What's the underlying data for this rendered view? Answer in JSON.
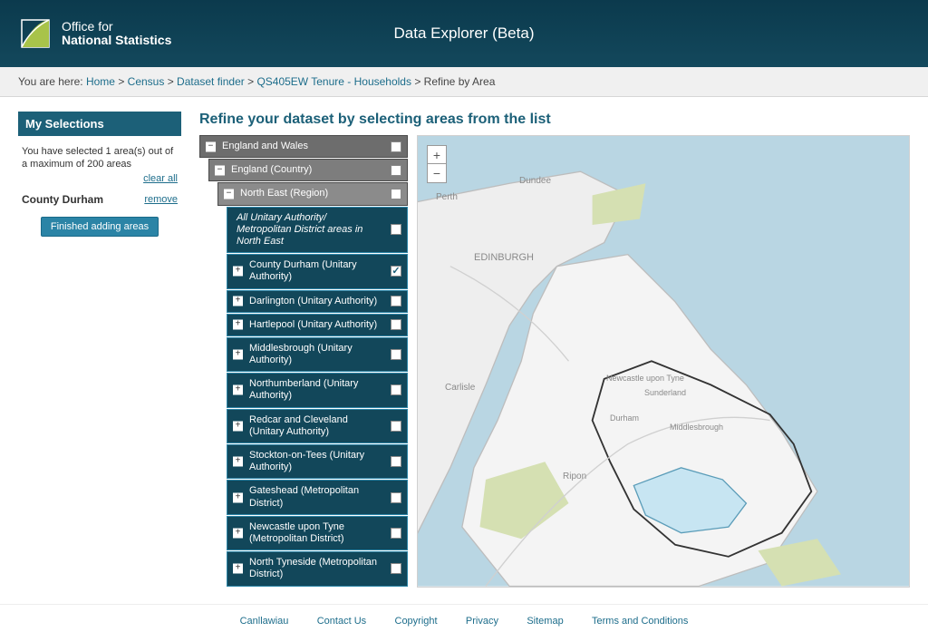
{
  "header": {
    "org_line1": "Office for",
    "org_line2": "National Statistics",
    "app_title": "Data Explorer (Beta)"
  },
  "breadcrumb": {
    "prefix": "You are here: ",
    "items": [
      "Home",
      "Census",
      "Dataset finder",
      "QS405EW Tenure - Households",
      "Refine by Area"
    ],
    "sep": " > "
  },
  "sidebar": {
    "title": "My Selections",
    "summary": "You have selected 1 area(s) out of a maximum of 200 areas",
    "clear_all": "clear all",
    "selected": {
      "name": "County Durham",
      "remove_label": "remove"
    },
    "finished_label": "Finished adding areas"
  },
  "main": {
    "heading": "Refine your dataset by selecting areas from the list"
  },
  "tree": {
    "l0": {
      "label": "England and Wales",
      "expanded": true
    },
    "l1": {
      "label": "England (Country)",
      "expanded": true
    },
    "l2": {
      "label": "North East (Region)",
      "expanded": true
    },
    "all_areas": "All Unitary Authority/ Metropolitan District areas in North East",
    "items": [
      {
        "label": "County Durham (Unitary Authority)",
        "checked": true
      },
      {
        "label": "Darlington (Unitary Authority)",
        "checked": false
      },
      {
        "label": "Hartlepool (Unitary Authority)",
        "checked": false
      },
      {
        "label": "Middlesbrough (Unitary Authority)",
        "checked": false
      },
      {
        "label": "Northumberland (Unitary Authority)",
        "checked": false
      },
      {
        "label": "Redcar and Cleveland (Unitary Authority)",
        "checked": false
      },
      {
        "label": "Stockton-on-Tees (Unitary Authority)",
        "checked": false
      },
      {
        "label": "Gateshead (Metropolitan District)",
        "checked": false
      },
      {
        "label": "Newcastle upon Tyne (Metropolitan District)",
        "checked": false
      },
      {
        "label": "North Tyneside (Metropolitan District)",
        "checked": false
      }
    ]
  },
  "map": {
    "labels": {
      "perth": "Perth",
      "dundee": "Dundee",
      "edinburgh": "EDINBURGH",
      "carlisle": "Carlisle",
      "newcastle": "Newcastle upon Tyne",
      "sunderland": "Sunderland",
      "durham": "Durham",
      "middlesbrough": "Middlesbrough",
      "ripon": "Ripon"
    },
    "highlight_color": "#c7e5f2"
  },
  "footer": {
    "links": [
      "Canllawiau",
      "Contact Us",
      "Copyright",
      "Privacy",
      "Sitemap",
      "Terms and Conditions"
    ]
  }
}
